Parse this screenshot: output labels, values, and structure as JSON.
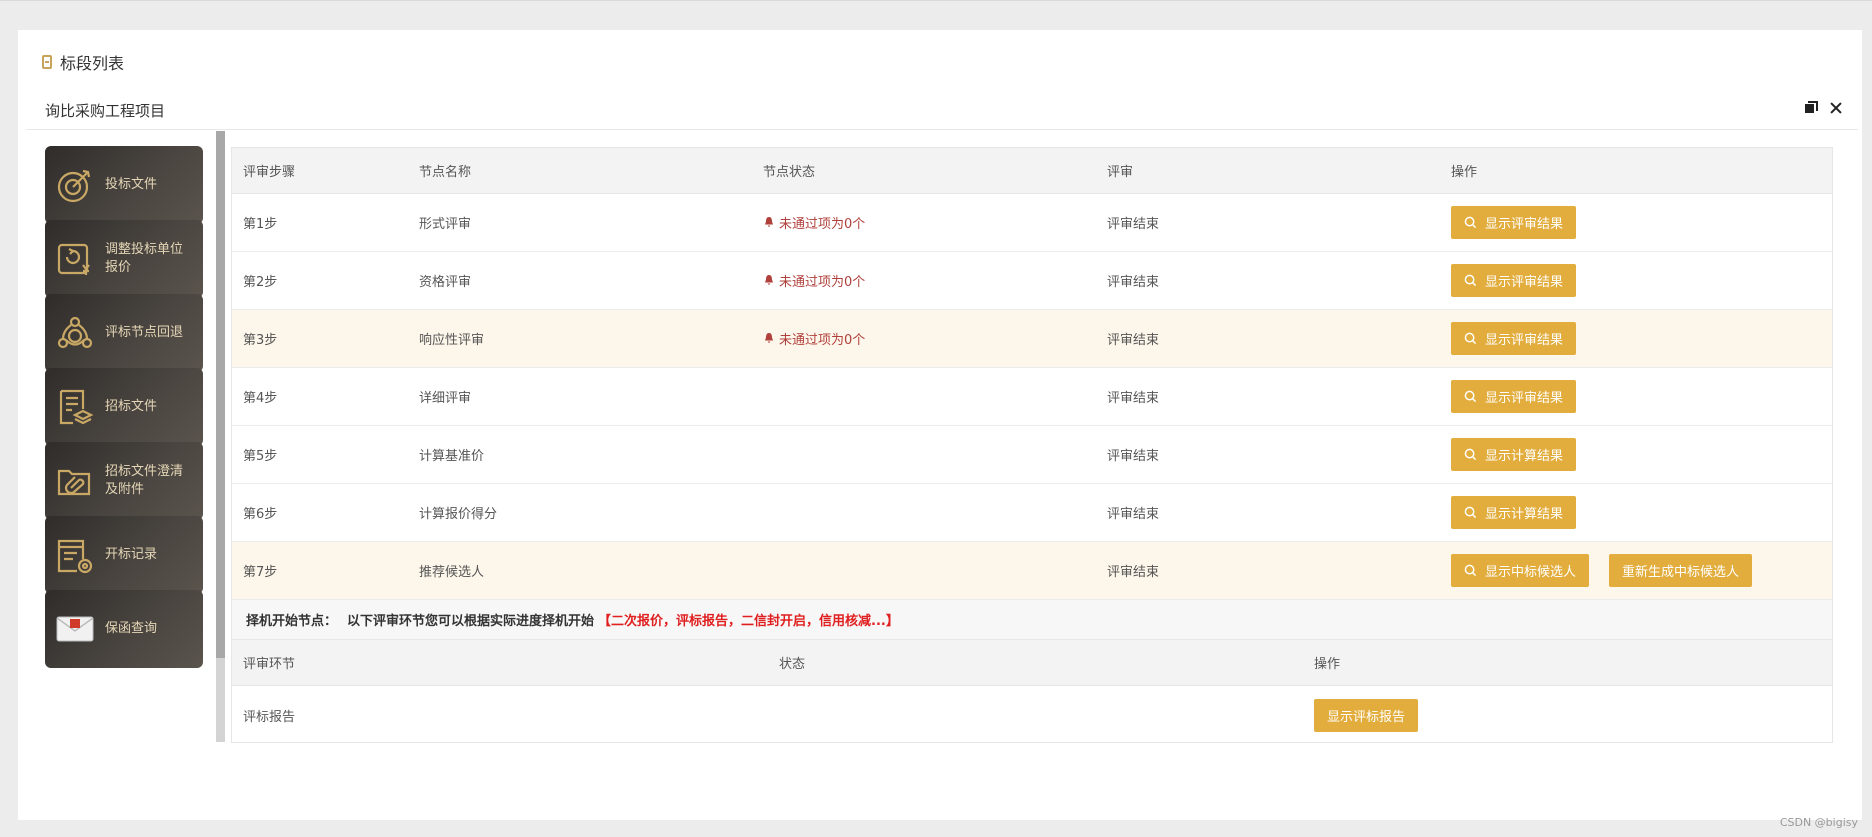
{
  "page": {
    "title": "标段列表",
    "watermark": "CSDN @bigisy"
  },
  "modal": {
    "title": "询比采购工程项目"
  },
  "menu": {
    "items": [
      {
        "label": "投标文件",
        "icon": "target-icon"
      },
      {
        "label": "调整投标单位报价",
        "icon": "price-refresh-icon"
      },
      {
        "label": "评标节点回退",
        "icon": "node-rollback-icon"
      },
      {
        "label": "招标文件",
        "icon": "document-stack-icon"
      },
      {
        "label": "招标文件澄清及附件",
        "icon": "folder-attachment-icon"
      },
      {
        "label": "开标记录",
        "icon": "record-icon"
      },
      {
        "label": "保函查询",
        "icon": "envelope-icon"
      }
    ]
  },
  "review_table": {
    "headers": [
      "评审步骤",
      "节点名称",
      "节点状态",
      "评审",
      "操作"
    ],
    "rows": [
      {
        "step": "第1步",
        "name": "形式评审",
        "status": "未通过项为0个",
        "review": "评审结束",
        "actions": [
          "显示评审结果"
        ]
      },
      {
        "step": "第2步",
        "name": "资格评审",
        "status": "未通过项为0个",
        "review": "评审结束",
        "actions": [
          "显示评审结果"
        ]
      },
      {
        "step": "第3步",
        "name": "响应性评审",
        "status": "未通过项为0个",
        "review": "评审结束",
        "actions": [
          "显示评审结果"
        ]
      },
      {
        "step": "第4步",
        "name": "详细评审",
        "status": "",
        "review": "评审结束",
        "actions": [
          "显示评审结果"
        ]
      },
      {
        "step": "第5步",
        "name": "计算基准价",
        "status": "",
        "review": "评审结束",
        "actions": [
          "显示计算结果"
        ]
      },
      {
        "step": "第6步",
        "name": "计算报价得分",
        "status": "",
        "review": "评审结束",
        "actions": [
          "显示计算结果"
        ]
      },
      {
        "step": "第7步",
        "name": "推荐候选人",
        "status": "",
        "review": "评审结束",
        "actions": [
          "显示中标候选人",
          "重新生成中标候选人"
        ]
      }
    ]
  },
  "notice": {
    "label": "择机开始节点：",
    "text": "以下评审环节您可以根据实际进度择机开始",
    "highlight": "【二次报价，评标报告，二信封开启，信用核减...】"
  },
  "optional_table": {
    "headers": [
      "评审环节",
      "状态",
      "操作"
    ],
    "rows": [
      {
        "name": "评标报告",
        "status": "",
        "action": "显示评标报告"
      }
    ]
  },
  "colors": {
    "accent": "#e2ad3c",
    "fail_text": "#b0403b",
    "notice_red": "#e02020",
    "menu_dark": "#3a3632"
  }
}
